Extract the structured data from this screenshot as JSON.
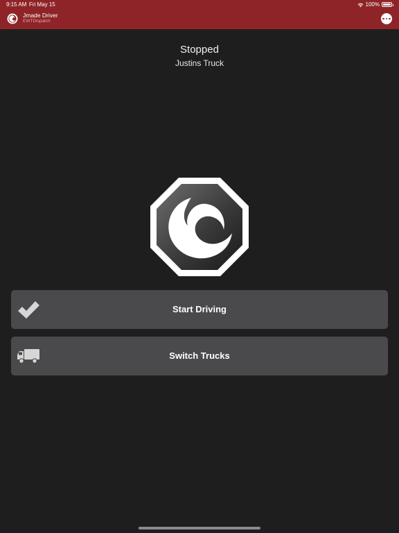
{
  "status_bar": {
    "time": "9:15 AM",
    "date": "Fri May 15",
    "battery": "100%"
  },
  "header": {
    "app_name": "Jmade Driver",
    "subtitle": "EWTDispatch",
    "background_color": "#8e2427",
    "more_icon": "ellipsis-circle-icon",
    "logo_icon": "wave-logo-icon"
  },
  "main": {
    "status": "Stopped",
    "truck_name": "Justins Truck",
    "state_icon": "stop-sign-logo-icon"
  },
  "actions": [
    {
      "label": "Start Driving",
      "icon": "checkmark-icon"
    },
    {
      "label": "Switch Trucks",
      "icon": "truck-icon"
    }
  ]
}
